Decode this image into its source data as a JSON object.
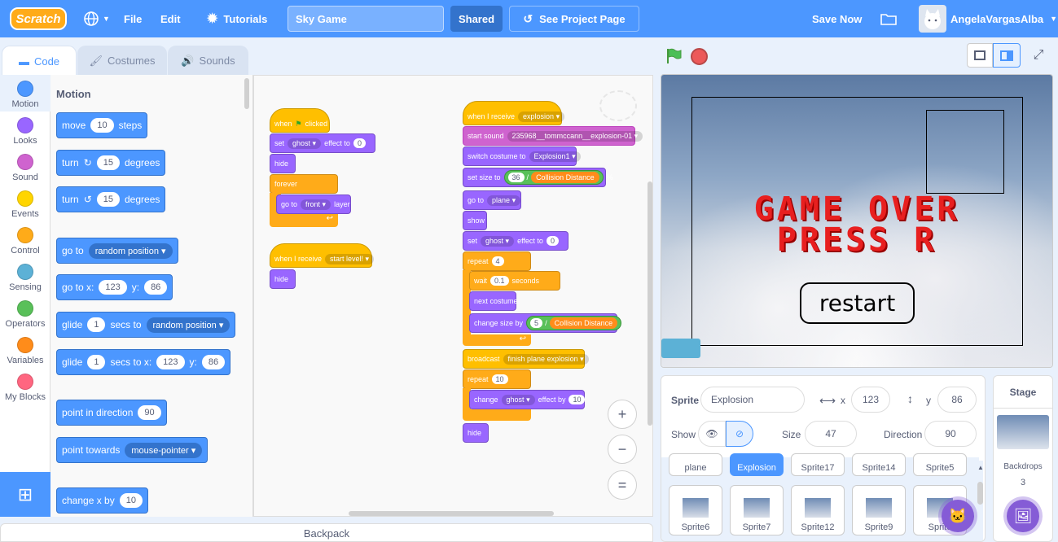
{
  "menu": {
    "logo": "Scratch",
    "file": "File",
    "edit": "Edit",
    "tutorials": "Tutorials",
    "project_title": "Sky Game",
    "shared": "Shared",
    "see_project": "See Project Page",
    "save_now": "Save Now",
    "username": "AngelaVargasAlba"
  },
  "tabs": {
    "code": "Code",
    "costumes": "Costumes",
    "sounds": "Sounds"
  },
  "categories": [
    {
      "label": "Motion",
      "color": "#4c97ff"
    },
    {
      "label": "Looks",
      "color": "#9966ff"
    },
    {
      "label": "Sound",
      "color": "#cf63cf"
    },
    {
      "label": "Events",
      "color": "#ffd500"
    },
    {
      "label": "Control",
      "color": "#ffab19"
    },
    {
      "label": "Sensing",
      "color": "#5cb1d6"
    },
    {
      "label": "Operators",
      "color": "#59c059"
    },
    {
      "label": "Variables",
      "color": "#ff8c1a"
    },
    {
      "label": "My Blocks",
      "color": "#ff6680"
    }
  ],
  "palette": {
    "title": "Motion",
    "move": {
      "a": "move",
      "v": "10",
      "b": "steps"
    },
    "turn_right": {
      "a": "turn",
      "v": "15",
      "b": "degrees"
    },
    "turn_left": {
      "a": "turn",
      "v": "15",
      "b": "degrees"
    },
    "goto": {
      "a": "go to",
      "d": "random position"
    },
    "goto_xy": {
      "a": "go to x:",
      "x": "123",
      "b": "y:",
      "y": "86"
    },
    "glide": {
      "a": "glide",
      "v": "1",
      "b": "secs to",
      "d": "random position"
    },
    "glide_xy": {
      "a": "glide",
      "v": "1",
      "b": "secs to x:",
      "x": "123",
      "c": "y:",
      "y": "86"
    },
    "point_dir": {
      "a": "point in direction",
      "v": "90"
    },
    "point_towards": {
      "a": "point towards",
      "d": "mouse-pointer"
    },
    "change_x": {
      "a": "change x by",
      "v": "10"
    }
  },
  "script1": {
    "hat_a": "when",
    "hat_b": "clicked",
    "set1": {
      "a": "set",
      "d": "ghost",
      "b": "effect to",
      "v": "0"
    },
    "hide": "hide",
    "forever": "forever",
    "goto": {
      "a": "go to",
      "d": "front",
      "b": "layer"
    }
  },
  "script2": {
    "hat": "when I receive",
    "d": "start level!",
    "hide": "hide"
  },
  "script3": {
    "hat": "when I receive",
    "hat_d": "explosion",
    "start_sound": "start sound",
    "sound_d": "235968__tommccann__explosion-01",
    "switch": "switch costume to",
    "costume_d": "Explosion1",
    "setsize": "set size to",
    "size_v": "36",
    "slash": "/",
    "coll": "Collision Distance",
    "pct": "%",
    "goto": "go to",
    "goto_d": "plane",
    "show": "show",
    "set": "set",
    "set_d": "ghost",
    "effect_to": "effect to",
    "set_v": "0",
    "repeat1": "repeat",
    "repeat1_v": "4",
    "wait": "wait",
    "wait_v": "0.1",
    "seconds": "seconds",
    "next": "next costume",
    "change_size": "change size by",
    "cs_v": "5",
    "cs_slash": "/",
    "cs_coll": "Collision Distance",
    "broadcast": "broadcast",
    "broadcast_d": "finish plane explosion",
    "repeat2": "repeat",
    "repeat2_v": "10",
    "change": "change",
    "change_d": "ghost",
    "effect_by": "effect by",
    "change_v": "10",
    "hide": "hide"
  },
  "zoom": {
    "in": "+",
    "out": "−",
    "reset": "="
  },
  "backpack": "Backpack",
  "stage": {
    "line1": "GAME OVER",
    "line2": "PRESS R",
    "restart": "restart"
  },
  "sprite_info": {
    "label": "Sprite",
    "name": "Explosion",
    "x_label": "x",
    "x": "123",
    "y_label": "y",
    "y": "86",
    "show_label": "Show",
    "size_label": "Size",
    "size": "47",
    "direction_label": "Direction",
    "direction": "90"
  },
  "sprites_row1": [
    "plane",
    "Explosion",
    "Sprite17",
    "Sprite14",
    "Sprite5"
  ],
  "sprites_row2": [
    "Sprite6",
    "Sprite7",
    "Sprite12",
    "Sprite9",
    "Sprite"
  ],
  "stage_pane": {
    "title": "Stage",
    "backdrops_label": "Backdrops",
    "backdrops_count": "3"
  }
}
